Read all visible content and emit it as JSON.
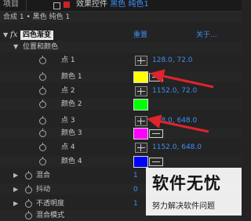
{
  "topbar": {
    "project_tab": "项目",
    "tab_title_prefix": "效果控件",
    "tab_title_layer": "黑色 纯色1"
  },
  "breadcrumb": "合成 1 • 黑色 纯色 1",
  "effect": {
    "name": "四色渐变",
    "reset": "重置",
    "about": "关于..."
  },
  "group": {
    "label": "位置和颜色"
  },
  "properties": [
    {
      "label": "点 1",
      "value": "128.0, 72.0"
    },
    {
      "label": "颜色 1",
      "color": "#ffff00"
    },
    {
      "label": "点 2",
      "value": "1152.0, 72.0"
    },
    {
      "label": "颜色 2",
      "color": "#00ff00"
    },
    {
      "label": "点 3",
      "value": "128.0, 648.0"
    },
    {
      "label": "颜色 3",
      "color": "#ff00ff"
    },
    {
      "label": "点 4",
      "value": "1152.0, 648.0"
    },
    {
      "label": "颜色 4",
      "color": "#0000ff"
    }
  ],
  "extra_props": [
    {
      "label": "混合",
      "value": "1"
    },
    {
      "label": "抖动",
      "value": "0"
    },
    {
      "label": "不透明度",
      "value": "1"
    },
    {
      "label": "混合模式"
    }
  ],
  "watermark": {
    "title": "软件无忧",
    "subtitle": "努力解决软件问题"
  },
  "colors": {
    "accent": "#3d8ff0",
    "arrow": "#e0232c"
  }
}
